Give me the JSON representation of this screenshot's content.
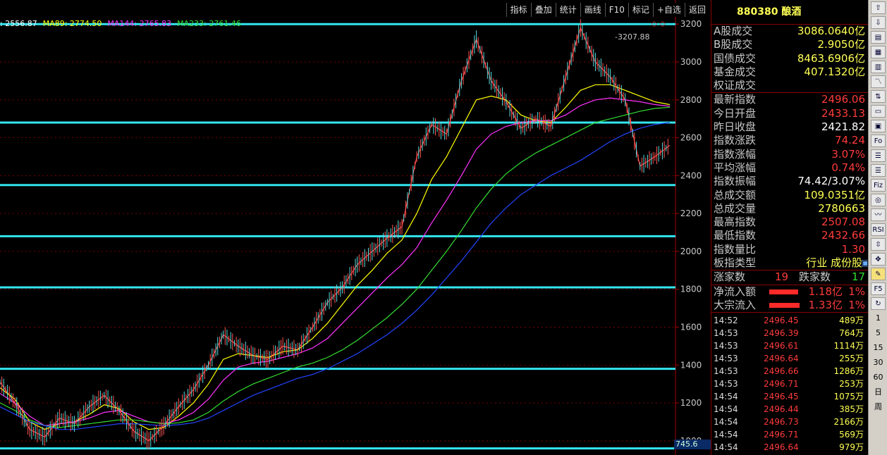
{
  "toolbar": {
    "buttons": [
      "指标",
      "叠加",
      "统计",
      "画线",
      "F10",
      "标记",
      "+自选",
      "返回"
    ]
  },
  "ma_legend": [
    {
      "text": ": 2556.87",
      "color": "#ffffff"
    },
    {
      "text": "MA89: 2774.50",
      "color": "#ffff00"
    },
    {
      "text": "MA144: 2765.83",
      "color": "#ff33ff"
    },
    {
      "text": "MA233: 2761.46",
      "color": "#33dd33"
    }
  ],
  "chart_data": {
    "type": "line",
    "title": "",
    "ylabel": "",
    "xlabel": "",
    "ylim": [
      925,
      3290
    ],
    "y_ticks": [
      1000,
      1200,
      1400,
      1600,
      1800,
      2000,
      2200,
      2400,
      2600,
      2800,
      3000,
      3200
    ],
    "peak_label": "3207.88",
    "bottom_label": "745.6",
    "horizontal_lines": [
      3200,
      2680,
      2350,
      2080,
      1810,
      1380,
      960
    ],
    "series": [
      {
        "color": "#ff4444",
        "values": [
          1310,
          1200,
          1060,
          1020,
          1120,
          1090,
          1180,
          1240,
          1160,
          1050,
          1000,
          1080,
          1180,
          1270,
          1400,
          1560,
          1500,
          1450,
          1430,
          1500,
          1480,
          1600,
          1730,
          1810,
          1930,
          2000,
          2070,
          2130,
          2500,
          2670,
          2620,
          2900,
          3120,
          2900,
          2790,
          2650,
          2700,
          2660,
          2920,
          3180,
          3000,
          2920,
          2800,
          2450,
          2500,
          2560
        ]
      },
      {
        "color": "#ffff00",
        "values": [
          1280,
          1220,
          1100,
          1060,
          1090,
          1100,
          1140,
          1190,
          1170,
          1100,
          1060,
          1070,
          1130,
          1200,
          1300,
          1430,
          1460,
          1450,
          1440,
          1470,
          1480,
          1540,
          1620,
          1720,
          1820,
          1900,
          1990,
          2060,
          2200,
          2380,
          2500,
          2650,
          2800,
          2820,
          2800,
          2720,
          2690,
          2680,
          2760,
          2850,
          2880,
          2880,
          2850,
          2820,
          2790,
          2775
        ]
      },
      {
        "color": "#ff33ff",
        "values": [
          1250,
          1200,
          1130,
          1080,
          1090,
          1100,
          1120,
          1150,
          1160,
          1130,
          1100,
          1090,
          1110,
          1150,
          1220,
          1320,
          1390,
          1410,
          1420,
          1440,
          1460,
          1490,
          1540,
          1620,
          1700,
          1780,
          1860,
          1930,
          2020,
          2150,
          2270,
          2400,
          2540,
          2620,
          2660,
          2680,
          2690,
          2690,
          2720,
          2770,
          2800,
          2810,
          2800,
          2790,
          2775,
          2766
        ]
      },
      {
        "color": "#33dd33",
        "values": [
          1200,
          1160,
          1110,
          1080,
          1070,
          1080,
          1090,
          1100,
          1110,
          1110,
          1100,
          1090,
          1095,
          1110,
          1150,
          1210,
          1260,
          1300,
          1330,
          1360,
          1390,
          1410,
          1440,
          1480,
          1530,
          1590,
          1650,
          1720,
          1800,
          1900,
          2000,
          2110,
          2230,
          2330,
          2410,
          2470,
          2520,
          2560,
          2600,
          2640,
          2680,
          2700,
          2720,
          2740,
          2755,
          2761
        ]
      },
      {
        "color": "#2244ff",
        "values": [
          1180,
          1140,
          1100,
          1080,
          1060,
          1060,
          1070,
          1080,
          1090,
          1090,
          1085,
          1080,
          1085,
          1095,
          1120,
          1160,
          1200,
          1240,
          1270,
          1300,
          1330,
          1350,
          1380,
          1420,
          1460,
          1510,
          1560,
          1620,
          1690,
          1770,
          1860,
          1950,
          2050,
          2150,
          2230,
          2300,
          2350,
          2400,
          2440,
          2480,
          2530,
          2580,
          2620,
          2650,
          2670,
          2680
        ]
      }
    ]
  },
  "panel": {
    "title": "880380 酿酒",
    "rows_a": [
      {
        "label": "A股成交",
        "value": "3086.0640亿",
        "color": "#ffff55"
      },
      {
        "label": "B股成交",
        "value": "2.9050亿",
        "color": "#ffff55"
      },
      {
        "label": "国债成交",
        "value": "8463.6906亿",
        "color": "#ffff55"
      },
      {
        "label": "基金成交",
        "value": "407.1320亿",
        "color": "#ffff55"
      },
      {
        "label": "权证成交",
        "value": "",
        "color": "#ffff55"
      }
    ],
    "rows_b": [
      {
        "label": "最新指数",
        "value": "2496.06",
        "color": "#ff3b3b"
      },
      {
        "label": "今日开盘",
        "value": "2433.13",
        "color": "#ff3b3b"
      },
      {
        "label": "昨日收盘",
        "value": "2421.82",
        "color": "#ffffff"
      },
      {
        "label": "指数涨跌",
        "value": "74.24",
        "color": "#ff3b3b"
      },
      {
        "label": "指数涨幅",
        "value": "3.07%",
        "color": "#ff3b3b"
      },
      {
        "label": "平均涨幅",
        "value": "0.74%",
        "color": "#ff3b3b"
      },
      {
        "label": "指数振幅",
        "value": "74.42/3.07%",
        "color": "#ffffff"
      },
      {
        "label": "总成交额",
        "value": "109.0351亿",
        "color": "#ffff55"
      },
      {
        "label": "总成交量",
        "value": "2780663",
        "color": "#ffff55"
      },
      {
        "label": "最高指数",
        "value": "2507.08",
        "color": "#ff3b3b"
      },
      {
        "label": "最低指数",
        "value": "2432.66",
        "color": "#ff3b3b"
      },
      {
        "label": "指数量比",
        "value": "1.30",
        "color": "#ff3b3b"
      },
      {
        "label": "板指类型",
        "value": "行业 成份股",
        "color": "#ffff55"
      }
    ],
    "updown": {
      "up_label": "涨家数",
      "up_value": "19",
      "down_label": "跌家数",
      "down_value": "17"
    },
    "flows": [
      {
        "label": "净流入额",
        "value": "1.18亿",
        "pct": "1%",
        "bar": 0.85
      },
      {
        "label": "大宗流入",
        "value": "1.33亿",
        "pct": "1%",
        "bar": 0.9
      }
    ],
    "ticks": [
      {
        "time": "14:52",
        "price": "2496.45",
        "vol": "489万"
      },
      {
        "time": "14:53",
        "price": "2496.39",
        "vol": "764万"
      },
      {
        "time": "14:53",
        "price": "2496.61",
        "vol": "1114万"
      },
      {
        "time": "14:53",
        "price": "2496.64",
        "vol": "255万"
      },
      {
        "time": "14:53",
        "price": "2496.66",
        "vol": "1286万"
      },
      {
        "time": "14:53",
        "price": "2496.71",
        "vol": "253万"
      },
      {
        "time": "14:54",
        "price": "2496.45",
        "vol": "1075万"
      },
      {
        "time": "14:54",
        "price": "2496.44",
        "vol": "385万"
      },
      {
        "time": "14:54",
        "price": "2496.73",
        "vol": "2166万"
      },
      {
        "time": "14:54",
        "price": "2496.71",
        "vol": "569万"
      },
      {
        "time": "14:54",
        "price": "2496.64",
        "vol": "979万"
      }
    ]
  },
  "right_tools": [
    "⇧",
    "⇩",
    "▤",
    "▦",
    "▥",
    "〽",
    "⇅",
    "▭",
    "▣",
    "Fo",
    "☰",
    "☰",
    "Fiz",
    "◎",
    "〰",
    "RSI",
    "⇳",
    "✥",
    "✎",
    "F5",
    "↻",
    "1",
    "5",
    "15",
    "30",
    "60",
    "日",
    "周"
  ]
}
